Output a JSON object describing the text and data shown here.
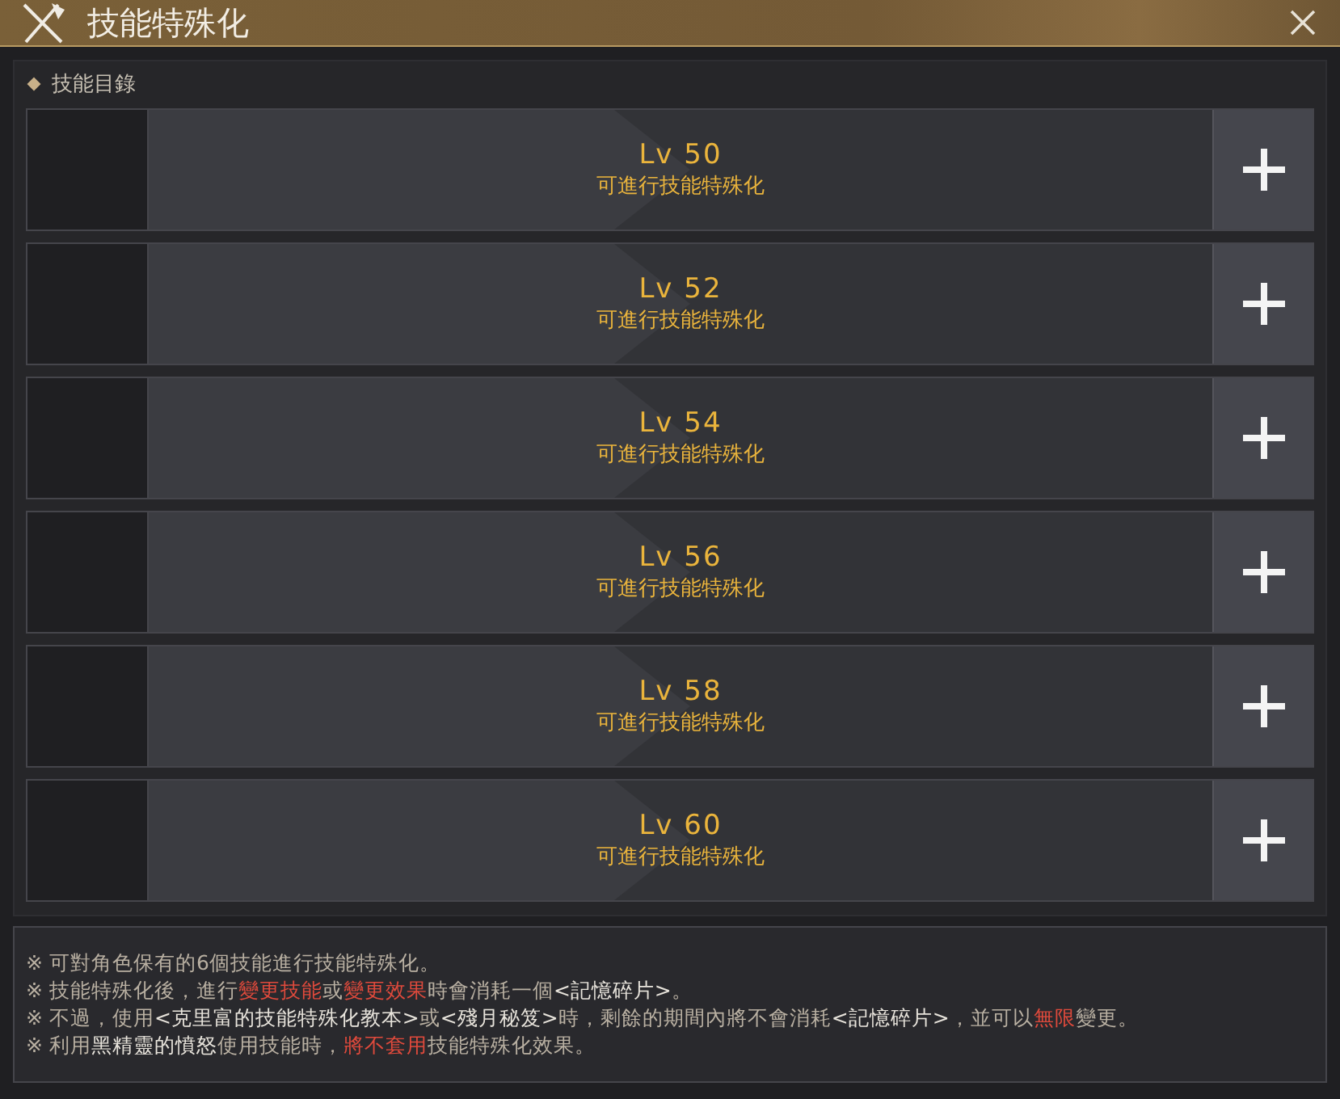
{
  "window": {
    "title": "技能特殊化"
  },
  "section": {
    "label": "技能目錄"
  },
  "slots": [
    {
      "level": "Lv 50",
      "status": "可進行技能特殊化"
    },
    {
      "level": "Lv 52",
      "status": "可進行技能特殊化"
    },
    {
      "level": "Lv 54",
      "status": "可進行技能特殊化"
    },
    {
      "level": "Lv 56",
      "status": "可進行技能特殊化"
    },
    {
      "level": "Lv 58",
      "status": "可進行技能特殊化"
    },
    {
      "level": "Lv 60",
      "status": "可進行技能特殊化"
    }
  ],
  "notes": [
    [
      {
        "text": "※ 可對角色保有的6個技能進行技能特殊化。",
        "kind": "normal"
      }
    ],
    [
      {
        "text": "※ 技能特殊化後，進行",
        "kind": "normal"
      },
      {
        "text": "變更技能",
        "kind": "red"
      },
      {
        "text": "或",
        "kind": "normal"
      },
      {
        "text": "變更效果",
        "kind": "red"
      },
      {
        "text": "時會消耗一個",
        "kind": "normal"
      },
      {
        "text": "<記憶碎片>",
        "kind": "bright"
      },
      {
        "text": "。",
        "kind": "normal"
      }
    ],
    [
      {
        "text": "※ 不過，使用",
        "kind": "normal"
      },
      {
        "text": "<克里富的技能特殊化教本>",
        "kind": "bright"
      },
      {
        "text": "或",
        "kind": "normal"
      },
      {
        "text": "<殘月秘笈>",
        "kind": "bright"
      },
      {
        "text": "時，剩餘的期間內將不會消耗",
        "kind": "normal"
      },
      {
        "text": "<記憶碎片>",
        "kind": "bright"
      },
      {
        "text": "，並可以",
        "kind": "normal"
      },
      {
        "text": "無限",
        "kind": "red"
      },
      {
        "text": "變更。",
        "kind": "normal"
      }
    ],
    [
      {
        "text": "※ 利用",
        "kind": "normal"
      },
      {
        "text": "黑精靈的憤怒",
        "kind": "bright"
      },
      {
        "text": "使用技能時，",
        "kind": "normal"
      },
      {
        "text": "將不套用",
        "kind": "red"
      },
      {
        "text": "技能特殊化效果。",
        "kind": "normal"
      }
    ]
  ]
}
